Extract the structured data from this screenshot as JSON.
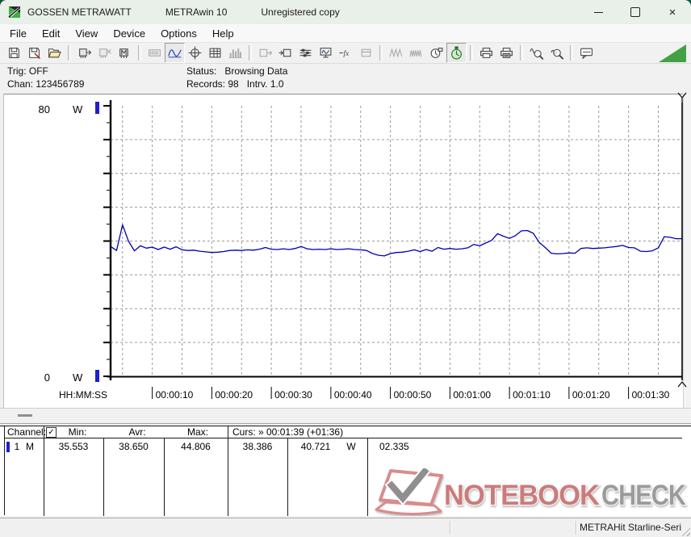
{
  "window": {
    "brand": "GOSSEN METRAWATT",
    "app": "METRAwin 10",
    "license": "Unregistered copy",
    "controls": {
      "minimize": "minimize",
      "maximize": "maximize",
      "close": "×"
    }
  },
  "menu": {
    "items": [
      "File",
      "Edit",
      "View",
      "Device",
      "Options",
      "Help"
    ]
  },
  "toolbar": {
    "buttons": [
      {
        "name": "save-button",
        "icon": "disk"
      },
      {
        "name": "save-as-button",
        "icon": "disk2"
      },
      {
        "name": "open-button",
        "icon": "folder"
      },
      {
        "sep": true
      },
      {
        "name": "device-read-button",
        "icon": "chip-out"
      },
      {
        "name": "device-disconnect-button",
        "icon": "chip-x",
        "disabled": true
      },
      {
        "name": "device-memory-button",
        "icon": "chip-m"
      },
      {
        "sep": true
      },
      {
        "name": "lcd-view-button",
        "icon": "lcd",
        "disabled": true
      },
      {
        "name": "trend-view-button",
        "icon": "wave",
        "pressed": true,
        "accent": true
      },
      {
        "name": "crosshair-view-button",
        "icon": "crosshair"
      },
      {
        "name": "table-view-button",
        "icon": "grid"
      },
      {
        "name": "bargraph-view-button",
        "icon": "bars",
        "disabled": true
      },
      {
        "sep": true
      },
      {
        "name": "export-button",
        "icon": "box-out",
        "disabled": true
      },
      {
        "name": "import-button",
        "icon": "box-in"
      },
      {
        "name": "channel-setup-button",
        "icon": "sliders"
      },
      {
        "name": "online-monitor-button",
        "icon": "monitor"
      },
      {
        "name": "formula-button",
        "icon": "fx"
      },
      {
        "name": "device-config-button",
        "icon": "box",
        "disabled": true
      },
      {
        "sep": true
      },
      {
        "name": "sample-rate-button",
        "icon": "wave2",
        "disabled": true
      },
      {
        "name": "sample-dense-button",
        "icon": "wave3",
        "disabled": true
      },
      {
        "name": "time-sync-button",
        "icon": "clock"
      },
      {
        "name": "interval-button",
        "icon": "stopwatch",
        "pressed": true
      },
      {
        "sep": true
      },
      {
        "name": "print-preview-button",
        "icon": "printer"
      },
      {
        "name": "print-button",
        "icon": "printer2"
      },
      {
        "sep": true
      },
      {
        "name": "zoom-time-button",
        "icon": "mag-wave"
      },
      {
        "name": "zoom-value-button",
        "icon": "mag"
      },
      {
        "sep": true
      },
      {
        "name": "comment-button",
        "icon": "bubble"
      }
    ],
    "triangle_color": "#44a044"
  },
  "status_panel": {
    "trig": "Trig: OFF",
    "chan": "Chan: 123456789",
    "status": "Status:   Browsing Data",
    "records": "Records: 98   Intrv. 1.0"
  },
  "chart_data": {
    "type": "line",
    "y_axis_top_label": "80",
    "y_axis_bottom_label": "0",
    "y_unit": "W",
    "ylim": [
      0,
      80
    ],
    "y_grid_interval": 10,
    "y_tick_interval": 5,
    "x_axis_format_label": "HH:MM:SS",
    "x_grid_interval_seconds": 5,
    "x_tick_labels": [
      "00:00:10",
      "00:00:20",
      "00:00:30",
      "00:00:40",
      "00:00:50",
      "00:01:00",
      "00:01:10",
      "00:01:20",
      "00:01:30"
    ],
    "cursor": {
      "position_label": "00:01:39",
      "offset_label": "+01:36"
    },
    "series": [
      {
        "name": "channel-1-power-w",
        "color": "#0000b2",
        "t_start_seconds": 3,
        "t_step_seconds": 1,
        "values": [
          38.4,
          37.2,
          44.8,
          40.0,
          37.1,
          38.6,
          37.9,
          38.2,
          37.5,
          38.2,
          37.6,
          38.3,
          37.4,
          37.2,
          37.3,
          37.0,
          36.8,
          36.6,
          36.7,
          36.9,
          37.2,
          37.3,
          37.2,
          37.4,
          37.3,
          37.6,
          38.1,
          37.6,
          37.5,
          37.7,
          37.5,
          37.8,
          38.4,
          37.7,
          37.5,
          37.6,
          37.5,
          37.7,
          37.5,
          37.6,
          37.7,
          37.5,
          37.4,
          37.2,
          36.3,
          35.8,
          35.6,
          36.3,
          36.6,
          36.7,
          37.0,
          37.4,
          36.9,
          37.5,
          37.0,
          38.1,
          37.6,
          37.8,
          37.6,
          37.7,
          38.0,
          39.0,
          38.6,
          39.4,
          40.2,
          42.2,
          41.4,
          40.8,
          41.6,
          43.0,
          43.1,
          42.3,
          39.6,
          38.1,
          36.4,
          36.2,
          36.3,
          36.5,
          36.4,
          37.8,
          38.0,
          37.8,
          37.9,
          38.0,
          38.2,
          38.4,
          38.7,
          38.1,
          38.0,
          37.0,
          36.9,
          37.1,
          38.0,
          41.3,
          41.1,
          40.7,
          40.7
        ]
      }
    ],
    "stats": {
      "min": 35.553,
      "avg": 38.65,
      "max": 44.806
    }
  },
  "table": {
    "header": {
      "channel": "Channel:",
      "check": "✓",
      "min": "Min:",
      "avr": "Avr:",
      "max": "Max:",
      "cursor": "Curs: » 00:01:39 (+01:36)"
    },
    "row": {
      "channel": "1",
      "mode": "M",
      "min": "35.553",
      "avr": "38.650",
      "max": "44.806",
      "cursor_a": "38.386",
      "cursor_b": "40.721",
      "cursor_unit": "W",
      "delta": "02.335"
    }
  },
  "watermark": {
    "text_primary": "NOTEBOOK",
    "text_secondary": "CHECK",
    "color_primary": "#cb7b7b",
    "color_secondary": "#9b9b9b"
  },
  "status_bar": {
    "device": "METRAHit Starline-Seri"
  },
  "colors": {
    "line_blue": "#0000b2",
    "channel_marker_blue": "#1f1fd0",
    "grid_gray": "#9a9a9a",
    "titlebar_green_tint": "#e9efe9",
    "toolbar_triangle_green": "#44a044"
  }
}
